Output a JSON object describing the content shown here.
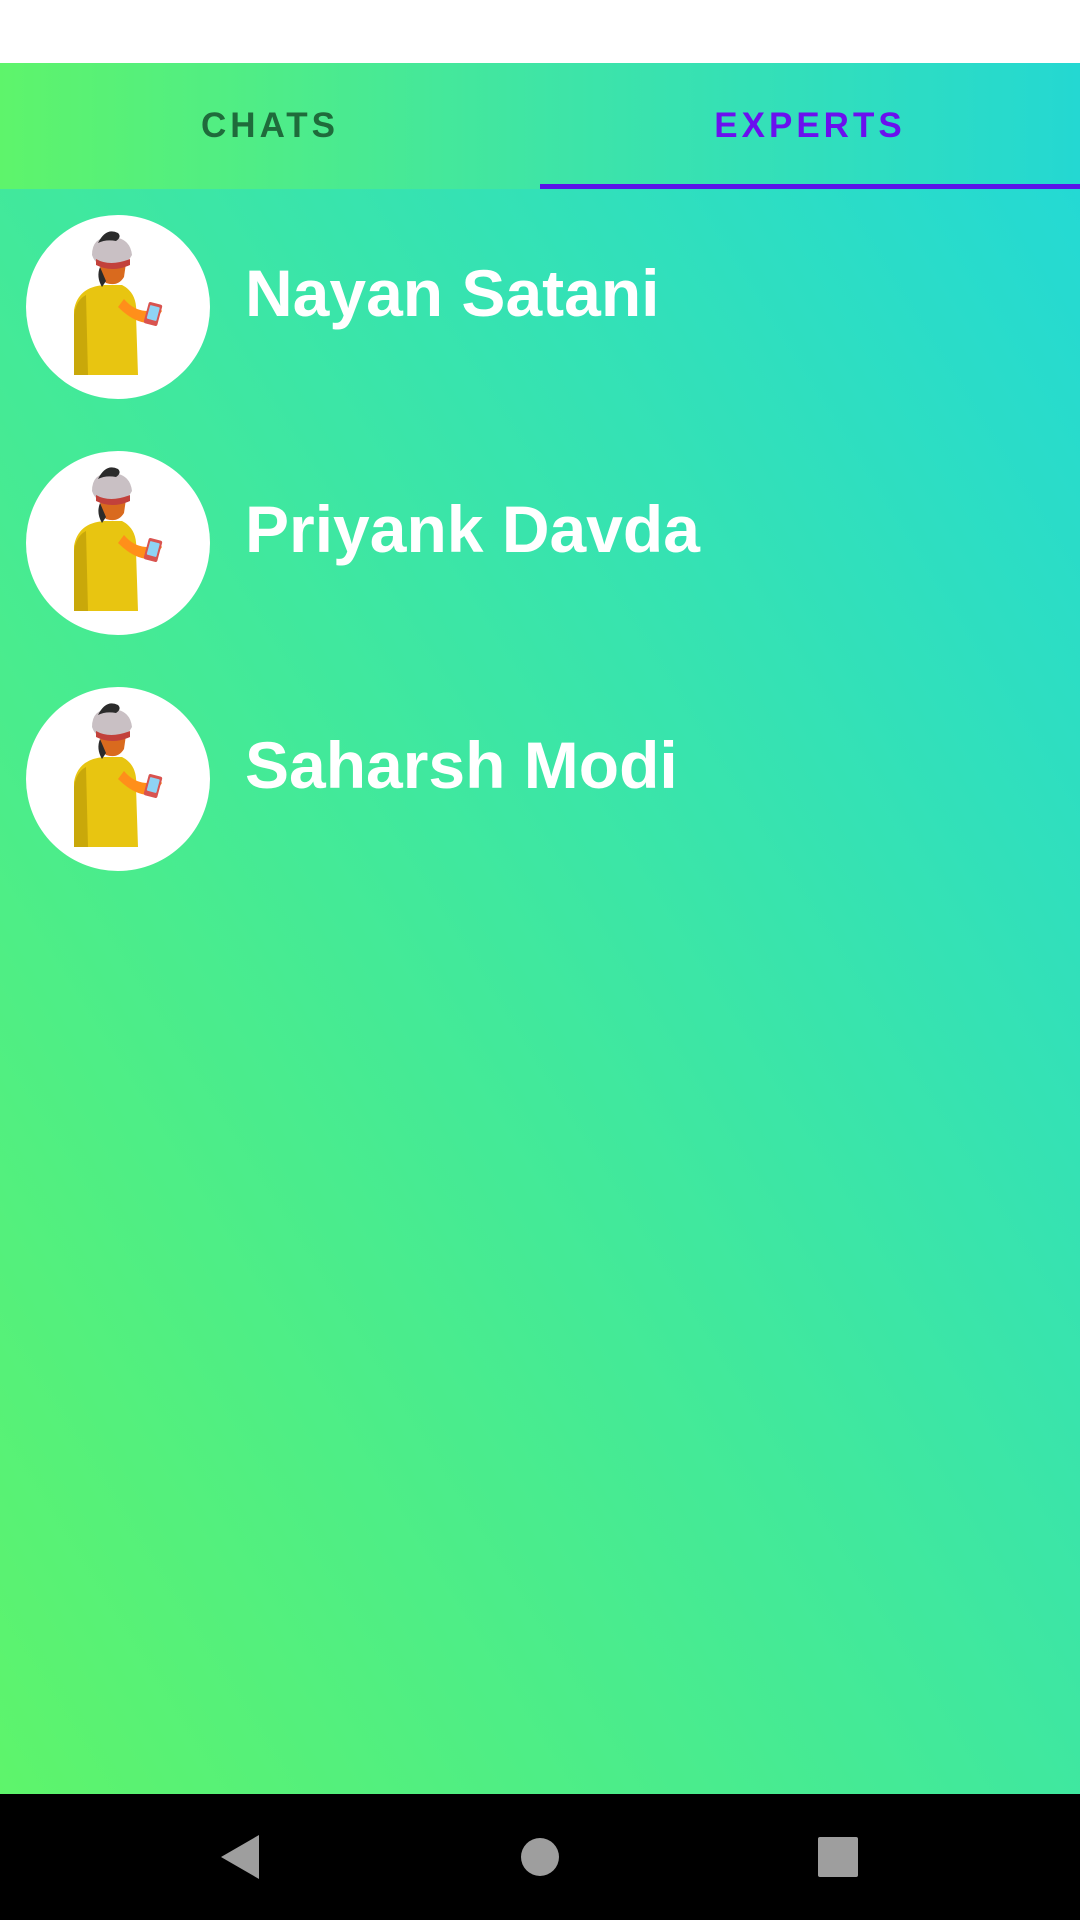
{
  "tabs": [
    {
      "label": "CHATS",
      "selected": false
    },
    {
      "label": "EXPERTS",
      "selected": true
    }
  ],
  "experts": [
    {
      "name": "Nayan Satani",
      "avatar": "man-with-phone-avatar"
    },
    {
      "name": "Priyank Davda",
      "avatar": "man-with-phone-avatar"
    },
    {
      "name": "Saharsh Modi",
      "avatar": "man-with-phone-avatar"
    }
  ],
  "navigation": {
    "back": "back-icon",
    "home": "home-icon",
    "recents": "recents-icon"
  },
  "colors": {
    "active_tab": "#6a10ee",
    "inactive_tab": "#1f6b3b",
    "tab_indicator": "#5a14e8",
    "gradient_start": "#5ef46b",
    "gradient_end": "#22d8d8",
    "navbar": "#000000"
  }
}
